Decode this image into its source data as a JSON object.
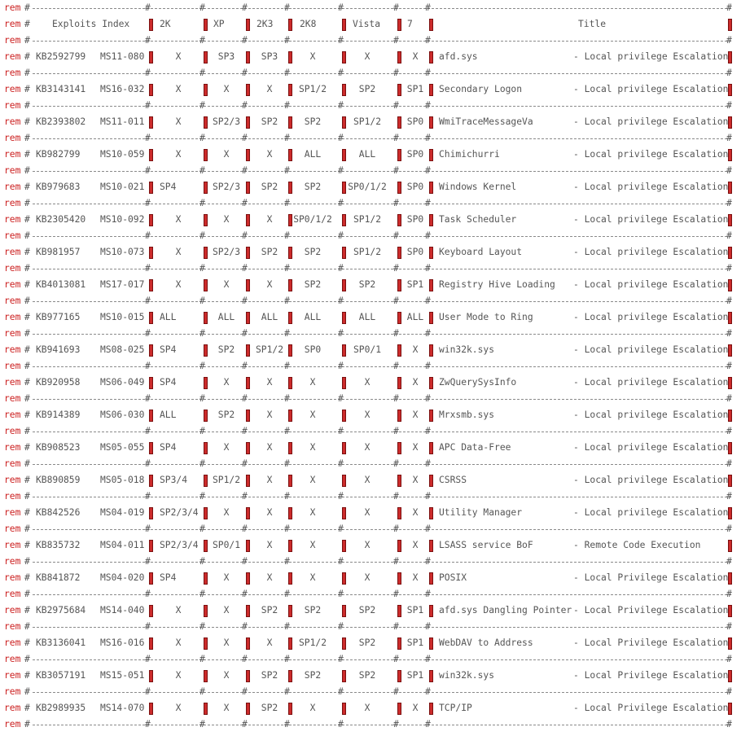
{
  "line_prefix": "rem",
  "comment_mark": "#",
  "header": {
    "index": "Exploits Index",
    "os": [
      "2K",
      "XP",
      "2K3",
      "2K8",
      "Vista",
      "7"
    ],
    "title": "Title"
  },
  "rows": [
    {
      "kb": "KB2592799",
      "ms": "MS11-080",
      "os": [
        "X",
        "SP3",
        "SP3",
        "X",
        "X",
        "X"
      ],
      "name": "afd.sys",
      "type": "- Local privilege Escalation"
    },
    {
      "kb": "KB3143141",
      "ms": "MS16-032",
      "os": [
        "X",
        "X",
        "X",
        "SP1/2",
        "SP2",
        "SP1"
      ],
      "name": "Secondary Logon",
      "type": "- Local privilege Escalation"
    },
    {
      "kb": "KB2393802",
      "ms": "MS11-011",
      "os": [
        "X",
        "SP2/3",
        "SP2",
        "SP2",
        "SP1/2",
        "SP0"
      ],
      "name": "WmiTraceMessageVa",
      "type": "- Local privilege Escalation"
    },
    {
      "kb": "KB982799",
      "ms": "MS10-059",
      "os": [
        "X",
        "X",
        "X",
        "ALL",
        "ALL",
        "SP0"
      ],
      "name": "Chimichurri",
      "type": "- Local privilege Escalation"
    },
    {
      "kb": "KB979683",
      "ms": "MS10-021",
      "os": [
        "SP4",
        "SP2/3",
        "SP2",
        "SP2",
        "SP0/1/2",
        "SP0"
      ],
      "name": "Windows Kernel",
      "type": "- Local privilege Escalation"
    },
    {
      "kb": "KB2305420",
      "ms": "MS10-092",
      "os": [
        "X",
        "X",
        "X",
        "SP0/1/2",
        "SP1/2",
        "SP0"
      ],
      "name": "Task Scheduler",
      "type": "- Local privilege Escalation"
    },
    {
      "kb": "KB981957",
      "ms": "MS10-073",
      "os": [
        "X",
        "SP2/3",
        "SP2",
        "SP2",
        "SP1/2",
        "SP0"
      ],
      "name": "Keyboard Layout",
      "type": "- Local privilege Escalation"
    },
    {
      "kb": "KB4013081",
      "ms": "MS17-017",
      "os": [
        "X",
        "X",
        "X",
        "SP2",
        "SP2",
        "SP1"
      ],
      "name": "Registry Hive Loading",
      "type": "- Local privilege Escalation"
    },
    {
      "kb": "KB977165",
      "ms": "MS10-015",
      "os": [
        "ALL",
        "ALL",
        "ALL",
        "ALL",
        "ALL",
        "ALL"
      ],
      "name": "User Mode to Ring",
      "type": "- Local privilege Escalation"
    },
    {
      "kb": "KB941693",
      "ms": "MS08-025",
      "os": [
        "SP4",
        "SP2",
        "SP1/2",
        "SP0",
        "SP0/1",
        "X"
      ],
      "name": "win32k.sys",
      "type": "- Local privilege Escalation"
    },
    {
      "kb": "KB920958",
      "ms": "MS06-049",
      "os": [
        "SP4",
        "X",
        "X",
        "X",
        "X",
        "X"
      ],
      "name": "ZwQuerySysInfo",
      "type": "- Local privilege Escalation"
    },
    {
      "kb": "KB914389",
      "ms": "MS06-030",
      "os": [
        "ALL",
        "SP2",
        "X",
        "X",
        "X",
        "X"
      ],
      "name": "Mrxsmb.sys",
      "type": "- Local privilege Escalation"
    },
    {
      "kb": "KB908523",
      "ms": "MS05-055",
      "os": [
        "SP4",
        "X",
        "X",
        "X",
        "X",
        "X"
      ],
      "name": "APC Data-Free",
      "type": "- Local privilege Escalation"
    },
    {
      "kb": "KB890859",
      "ms": "MS05-018",
      "os": [
        "SP3/4",
        "SP1/2",
        "X",
        "X",
        "X",
        "X"
      ],
      "name": "CSRSS",
      "type": "- Local privilege Escalation"
    },
    {
      "kb": "KB842526",
      "ms": "MS04-019",
      "os": [
        "SP2/3/4",
        "X",
        "X",
        "X",
        "X",
        "X"
      ],
      "name": "Utility Manager",
      "type": "- Local privilege Escalation"
    },
    {
      "kb": "KB835732",
      "ms": "MS04-011",
      "os": [
        "SP2/3/4",
        "SP0/1",
        "X",
        "X",
        "X",
        "X"
      ],
      "name": "LSASS service BoF",
      "type": "- Remote Code Execution"
    },
    {
      "kb": "KB841872",
      "ms": "MS04-020",
      "os": [
        "SP4",
        "X",
        "X",
        "X",
        "X",
        "X"
      ],
      "name": "POSIX",
      "type": "- Local Privilege Escalation"
    },
    {
      "kb": "KB2975684",
      "ms": "MS14-040",
      "os": [
        "X",
        "X",
        "SP2",
        "SP2",
        "SP2",
        "SP1"
      ],
      "name": "afd.sys Dangling Pointer",
      "type": "- Local Privilege Escalation"
    },
    {
      "kb": "KB3136041",
      "ms": "MS16-016",
      "os": [
        "X",
        "X",
        "X",
        "SP1/2",
        "SP2",
        "SP1"
      ],
      "name": "WebDAV to Address",
      "type": "- Local Privilege Escalation"
    },
    {
      "kb": "KB3057191",
      "ms": "MS15-051",
      "os": [
        "X",
        "X",
        "SP2",
        "SP2",
        "SP2",
        "SP1"
      ],
      "name": "win32k.sys",
      "type": "- Local Privilege Escalation"
    },
    {
      "kb": "KB2989935",
      "ms": "MS14-070",
      "os": [
        "X",
        "X",
        "SP2",
        "X",
        "X",
        "X"
      ],
      "name": "TCP/IP",
      "type": "- Local Privilege Escalation"
    }
  ]
}
